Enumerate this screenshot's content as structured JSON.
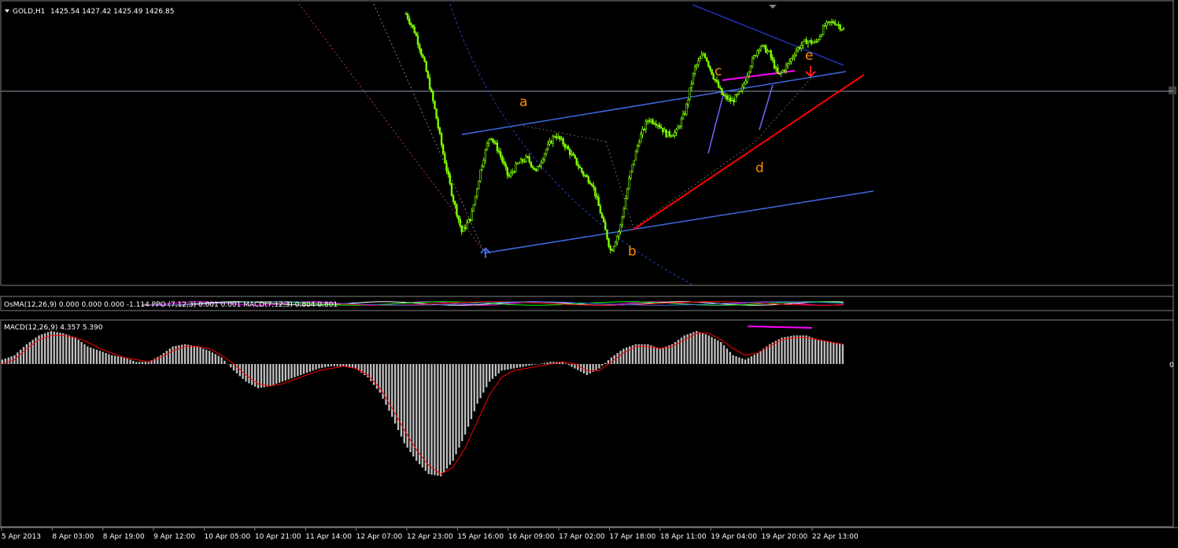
{
  "main_panel": {
    "title": "GOLD,H1",
    "ohlc": "1425.54 1427.42 1425.49 1426.85",
    "wave_labels": [
      "a",
      "b",
      "c",
      "d",
      "e"
    ]
  },
  "indicator_strip": {
    "label": "OsMA(12,26,9) 0.000 0.000 0.000 -1.114  PPO (7,12,3) 0.001 0.001  MACD(7,12,3) 0.804 0.801"
  },
  "macd_panel": {
    "label": "MACD(12,26,9) 4.357 5.390",
    "zero_label": "0"
  },
  "time_axis": {
    "labels": [
      "5 Apr 2013",
      "8 Apr 03:00",
      "8 Apr 19:00",
      "9 Apr 12:00",
      "10 Apr 05:00",
      "10 Apr 21:00",
      "11 Apr 14:00",
      "12 Apr 07:00",
      "12 Apr 23:00",
      "15 Apr 16:00",
      "16 Apr 09:00",
      "17 Apr 02:00",
      "17 Apr 18:00",
      "18 Apr 11:00",
      "19 Apr 04:00",
      "19 Apr 20:00",
      "22 Apr 13:00"
    ]
  },
  "colors": {
    "background": "#000000",
    "candles": "#7fff00",
    "channel": "#4169e1",
    "trendline": "#ff0000",
    "magenta": "#ff00ff",
    "wave_label": "#ff8c00",
    "histogram": "#c0c0c0",
    "signal": "#ff0000"
  },
  "chart_data": [
    {
      "type": "candlestick",
      "title": "GOLD,H1",
      "series": [
        {
          "name": "GOLD,H1",
          "approx_close_path": [
            1502,
            1492,
            1476,
            1455,
            1430,
            1408,
            1390,
            1398,
            1422,
            1440,
            1431,
            1418,
            1425,
            1428,
            1421,
            1432,
            1440,
            1435,
            1428,
            1420,
            1415,
            1398,
            1380,
            1392,
            1418,
            1437,
            1448,
            1446,
            1440,
            1441,
            1452,
            1474,
            1482,
            1470,
            1460,
            1457,
            1462,
            1476,
            1486,
            1482,
            1470,
            1476,
            1484,
            1488,
            1487,
            1496,
            1498,
            1494
          ]
        }
      ],
      "annotations": [
        "a",
        "b",
        "c",
        "d",
        "e"
      ]
    },
    {
      "type": "bar",
      "title": "MACD(12,26,9) 4.357 5.390",
      "series": [
        {
          "name": "MACD",
          "values": [
            2,
            4,
            9,
            13,
            15,
            14,
            12,
            8,
            6,
            4,
            3,
            1,
            1,
            4,
            8,
            9,
            8,
            6,
            3,
            -3,
            -8,
            -11,
            -10,
            -8,
            -6,
            -4,
            -2,
            -1,
            -1,
            -2,
            -6,
            -13,
            -24,
            -36,
            -44,
            -50,
            -51,
            -44,
            -32,
            -18,
            -8,
            -3,
            -2,
            -1,
            0,
            1,
            1,
            -2,
            -5,
            -2,
            3,
            7,
            9,
            9,
            7,
            9,
            13,
            15,
            13,
            10,
            4,
            2,
            5,
            9,
            12,
            13,
            13,
            11,
            10,
            9
          ]
        },
        {
          "name": "Signal",
          "values": [
            0,
            2,
            7,
            11,
            13,
            13,
            12,
            10,
            7,
            5,
            3,
            2,
            1,
            3,
            6,
            8,
            8,
            7,
            4,
            0,
            -5,
            -9,
            -10,
            -9,
            -7,
            -5,
            -3,
            -2,
            -1,
            -2,
            -5,
            -11,
            -20,
            -30,
            -39,
            -46,
            -50,
            -47,
            -38,
            -26,
            -14,
            -6,
            -3,
            -2,
            -1,
            0,
            1,
            0,
            -3,
            -3,
            1,
            5,
            8,
            8,
            7,
            8,
            11,
            14,
            14,
            11,
            7,
            4,
            5,
            8,
            11,
            12,
            12,
            11,
            10,
            9
          ]
        }
      ]
    }
  ]
}
